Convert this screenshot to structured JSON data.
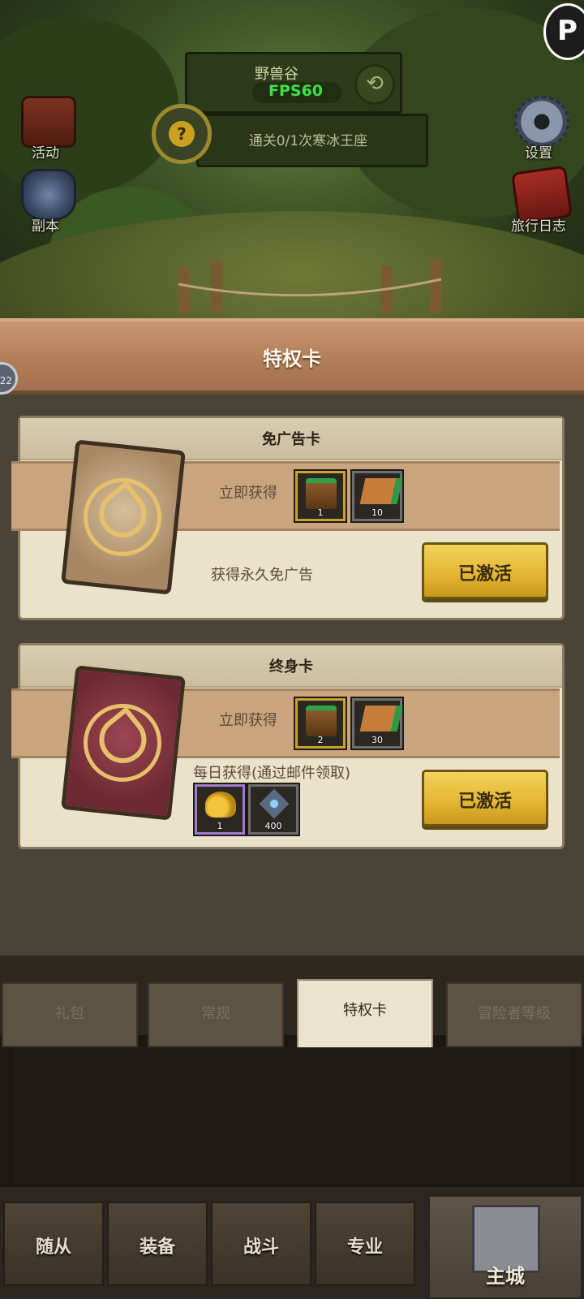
{
  "hud": {
    "level_name": "野兽谷",
    "fps": "FPS60",
    "quest": "通关0/1次寒冰王座",
    "quest_mark": "?",
    "refresh_glyph": "⟲",
    "corner_letter": "P",
    "player_level": "22"
  },
  "side_buttons": {
    "activity": "活动",
    "dungeon": "副本",
    "settings": "设置",
    "journal": "旅行日志"
  },
  "panel": {
    "title": "特权卡",
    "cards": [
      {
        "title": "免广告卡",
        "instant_label": "立即获得",
        "instant_items": [
          {
            "icon": "chest-icon",
            "qty": "1",
            "rarity": "gold"
          },
          {
            "icon": "ticket-icon",
            "qty": "10",
            "rarity": "gray"
          }
        ],
        "description": "获得永久免广告",
        "button": "已激活"
      },
      {
        "title": "终身卡",
        "instant_label": "立即获得",
        "instant_items": [
          {
            "icon": "chest-icon",
            "qty": "2",
            "rarity": "gold"
          },
          {
            "icon": "ticket-icon",
            "qty": "30",
            "rarity": "gray"
          }
        ],
        "daily_label": "每日获得(通过邮件领取)",
        "daily_items": [
          {
            "icon": "gold-pile-icon",
            "qty": "1",
            "rarity": "purple"
          },
          {
            "icon": "gem-icon",
            "qty": "400",
            "rarity": "gray"
          }
        ],
        "button": "已激活"
      }
    ]
  },
  "tabs": [
    {
      "label": "礼包",
      "active": false
    },
    {
      "label": "常规",
      "active": false
    },
    {
      "label": "特权卡",
      "active": true
    },
    {
      "label": "冒险者等级",
      "active": false
    }
  ],
  "bottom_nav": [
    "随从",
    "装备",
    "战斗",
    "专业",
    "主城"
  ],
  "colors": {
    "accent_button": "#e1b531",
    "panel_header": "#b5815c",
    "card_bg": "#ebe2cc"
  }
}
